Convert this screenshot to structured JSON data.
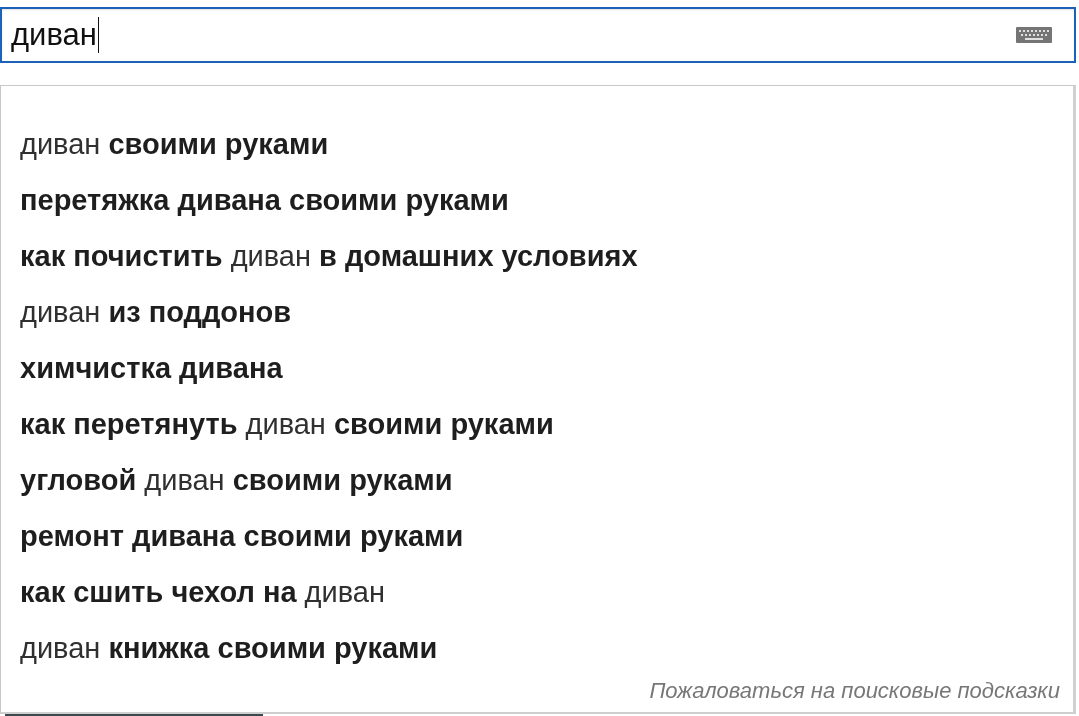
{
  "search_field": {
    "value": "диван"
  },
  "suggestions": [
    {
      "text": "диван **своими руками**",
      "bold": false
    },
    {
      "text": "перетяжка дивана своими руками",
      "bold": true
    },
    {
      "text": "**как почистить** диван **в домашних условиях**",
      "bold": false
    },
    {
      "text": "диван **из поддонов**",
      "bold": false
    },
    {
      "text": "химчистка дивана",
      "bold": true
    },
    {
      "text": "**как перетянуть** диван **своими руками**",
      "bold": false
    },
    {
      "text": "**угловой** диван **своими руками**",
      "bold": false
    },
    {
      "text": "ремонт дивана своими руками",
      "bold": true
    },
    {
      "text": "**как сшить чехол на** диван",
      "bold": false
    },
    {
      "text": "диван **книжка своими руками**",
      "bold": false
    }
  ],
  "report_link": "Пожаловаться на поисковые подсказки"
}
